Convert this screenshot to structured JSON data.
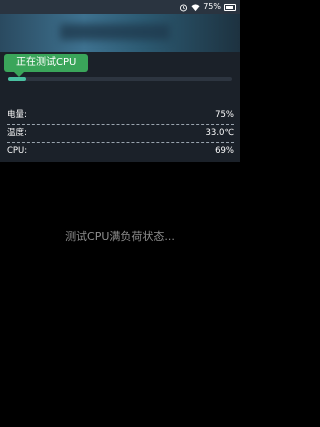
{
  "status_bar": {
    "battery_percent": "75%",
    "battery_level": 0.75,
    "icons": [
      "alarm-icon",
      "wifi-icon",
      "battery-icon"
    ]
  },
  "test_panel": {
    "tag_label": "正在测试CPU",
    "progress_fraction": 0.08,
    "progress_color": "#49c0a0",
    "tag_color": "#3aa55a",
    "stats": [
      {
        "label": "电量:",
        "value": "75%"
      },
      {
        "label": "温度:",
        "value": "33.0℃"
      },
      {
        "label": "CPU:",
        "value": "69%"
      }
    ]
  },
  "main": {
    "status_message": "测试CPU满负荷状态..."
  }
}
